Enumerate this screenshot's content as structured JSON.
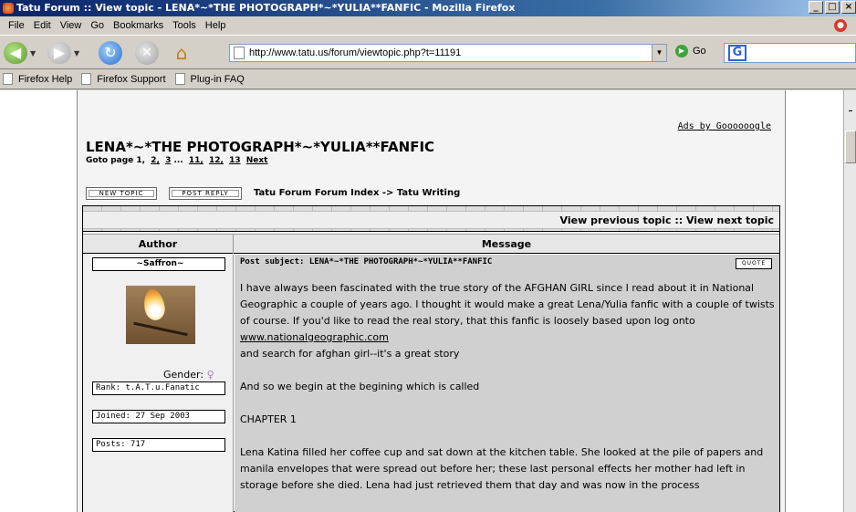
{
  "window": {
    "title": "Tatu Forum :: View topic - LENA*~*THE PHOTOGRAPH*~*YULIA**FANFIC - Mozilla Firefox",
    "minimize": "_",
    "maximize": "□",
    "close": "×"
  },
  "menu": {
    "items": [
      "File",
      "Edit",
      "View",
      "Go",
      "Bookmarks",
      "Tools",
      "Help"
    ]
  },
  "toolbar": {
    "url": "http://www.tatu.us/forum/viewtopic.php?t=11191",
    "go_label": "Go"
  },
  "bookmarks": [
    "Firefox Help",
    "Firefox Support",
    "Plug-in FAQ"
  ],
  "page": {
    "ads": "Ads by Goooooogle",
    "topic_title": "LENA*~*THE PHOTOGRAPH*~*YULIA**FANFIC",
    "goto_label": "Goto page",
    "pages": [
      "1,",
      "2,",
      "3",
      "...",
      "11,",
      "12,",
      "13",
      "Next"
    ],
    "new_topic": "NEW TOPIC",
    "post_reply": "POST REPLY",
    "nav_trail": "Tatu Forum Forum Index -> Tatu Writing",
    "view_topics": "View previous topic :: View next topic",
    "col_author": "Author",
    "col_message": "Message"
  },
  "post": {
    "author": "~Saffron~",
    "gender_label": "Gender:",
    "gender_symbol": "♀",
    "rank": "Rank: t.A.T.u.Fanatic",
    "joined": "Joined: 27 Sep 2003",
    "posts": "Posts: 717",
    "subject": "Post subject: LENA*~*THE PHOTOGRAPH*~*YULIA**FANFIC",
    "quote": "QUOTE",
    "para1": "I have always been fascinated with the true story of the AFGHAN GIRL since I read about it in National Geographic a couple of years ago. I thought it would make a great Lena/Yulia fanfic with a couple of twists of course. If you'd like to read the real story, that this fanfic is loosely based upon log onto",
    "link": "www.nationalgeographic.com",
    "para2": "and search for afghan girl--it's a great story",
    "para3": "And so we begin at the begining which is called",
    "para4": "CHAPTER 1",
    "para5": "Lena Katina filled her coffee cup and sat down at the kitchen table. She looked at the pile of papers and manila envelopes that were spread out before her; these last personal effects her mother had left in storage before she died. Lena had just retrieved them that day and was now in the process"
  }
}
